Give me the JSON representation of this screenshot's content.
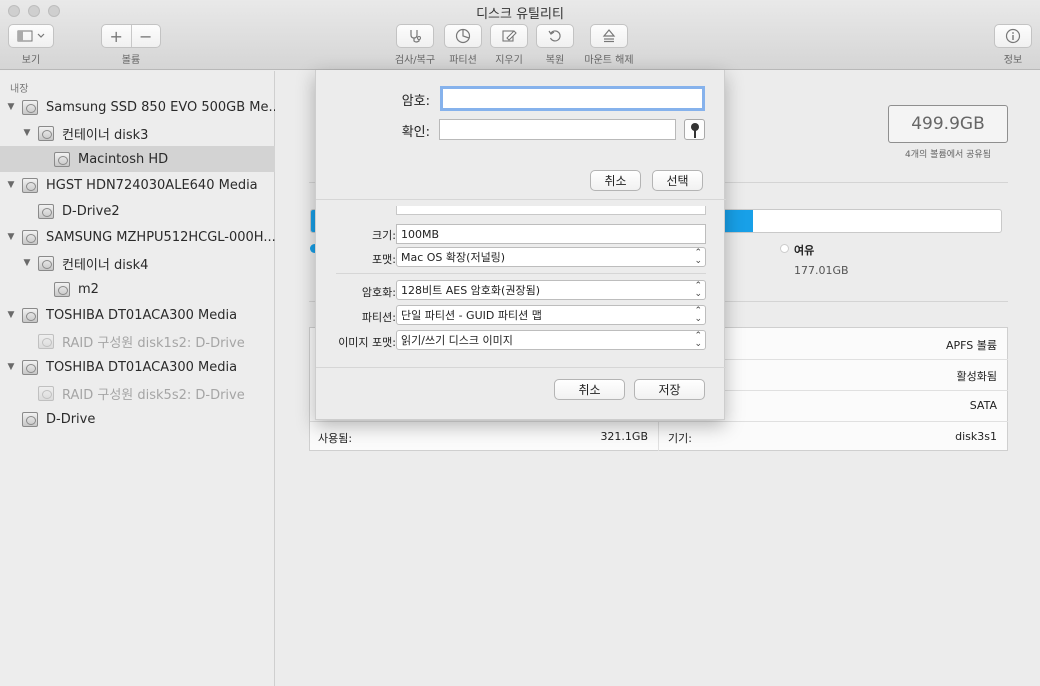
{
  "window": {
    "title": "디스크 유틸리티"
  },
  "toolbar": {
    "view_label": "보기",
    "volume_label": "볼륨",
    "add_symbol": "+",
    "remove_symbol": "−",
    "first_aid_label": "검사/복구",
    "partition_label": "파티션",
    "erase_label": "지우기",
    "restore_label": "복원",
    "unmount_label": "마운트 해제",
    "info_label": "정보"
  },
  "sidebar": {
    "header": "내장",
    "items": [
      {
        "label": "Samsung SSD 850 EVO 500GB Me..."
      },
      {
        "label": "컨테이너 disk3"
      },
      {
        "label": "Macintosh HD"
      },
      {
        "label": "HGST HDN724030ALE640 Media"
      },
      {
        "label": "D-Drive2"
      },
      {
        "label": "SAMSUNG MZHPU512HCGL-000H..."
      },
      {
        "label": "컨테이너 disk4"
      },
      {
        "label": "m2"
      },
      {
        "label": "TOSHIBA DT01ACA300 Media"
      },
      {
        "label": "RAID 구성원 disk1s2: D-Drive"
      },
      {
        "label": "TOSHIBA DT01ACA300 Media"
      },
      {
        "label": "RAID 구성원 disk5s2: D-Drive"
      },
      {
        "label": "D-Drive"
      }
    ]
  },
  "main": {
    "capacity": "499.9GB",
    "capacity_sub": "4개의 볼륨에서 공유됨",
    "usage_fraction": 0.64,
    "free_label": "여유",
    "free_value": "177.01GB",
    "info": {
      "type_value": "APFS 볼륨",
      "status_value": "활성화됨",
      "connection_value": "SATA",
      "used_label": "사용됨:",
      "used_value": "321.1GB",
      "device_label": "기기:",
      "device_value": "disk3s1"
    }
  },
  "password_sheet": {
    "password_label": "암호:",
    "verify_label": "확인:",
    "password_value": "",
    "verify_value": "",
    "cancel_label": "취소",
    "choose_label": "선택"
  },
  "save_dialog": {
    "size_label": "크기:",
    "size_value": "100MB",
    "format_label": "포맷:",
    "format_value": "Mac OS 확장(저널링)",
    "encryption_label": "암호화:",
    "encryption_value": "128비트 AES 암호화(권장됨)",
    "partition_label": "파티션:",
    "partition_value": "단일 파티션 - GUID 파티션 맵",
    "image_format_label": "이미지 포맷:",
    "image_format_value": "읽기/쓰기 디스크 이미지",
    "cancel_label": "취소",
    "save_label": "저장"
  },
  "colors": {
    "accent": "#18a0e8",
    "focus": "#86b2ec"
  }
}
